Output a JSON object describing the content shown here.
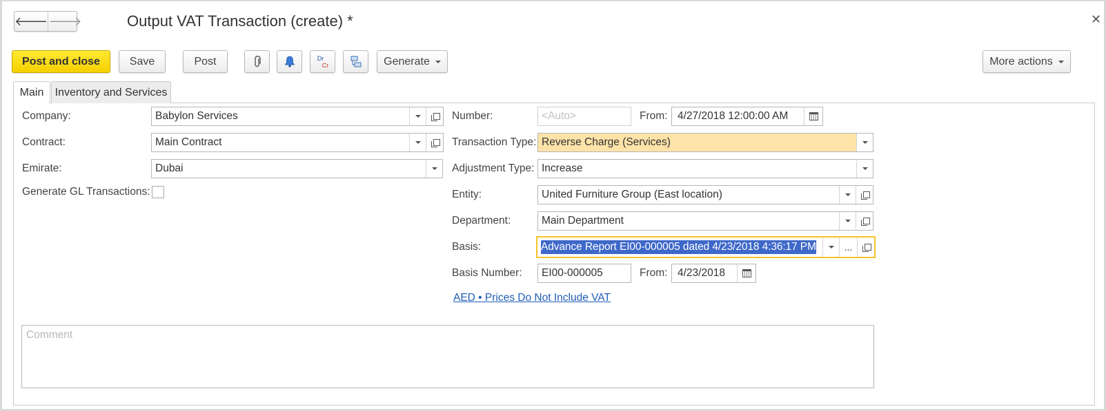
{
  "window": {
    "title": "Output VAT Transaction (create) *",
    "nav_back_icon": "arrow-left-icon",
    "nav_forward_icon": "arrow-right-icon",
    "close_icon": "close-icon"
  },
  "toolbar": {
    "post_and_close": "Post and close",
    "save": "Save",
    "post": "Post",
    "attach_icon": "paperclip-icon",
    "reminder_icon": "bell-icon",
    "drcr_dr": "Dr",
    "drcr_cr": "Cr",
    "structure_icon": "document-structure-icon",
    "generate": "Generate",
    "more_actions": "More actions"
  },
  "tabs": [
    {
      "label": "Main",
      "active": true
    },
    {
      "label": "Inventory and Services",
      "active": false
    }
  ],
  "left": {
    "company_label": "Company:",
    "company_value": "Babylon Services",
    "contract_label": "Contract:",
    "contract_value": "Main Contract",
    "emirate_label": "Emirate:",
    "emirate_value": "Dubai",
    "gl_label": "Generate GL Transactions:",
    "gl_checked": false
  },
  "right": {
    "number_label": "Number:",
    "number_placeholder": "<Auto>",
    "from_label": "From:",
    "from_value": "4/27/2018 12:00:00 AM",
    "ttype_label": "Transaction Type:",
    "ttype_value": "Reverse Charge (Services)",
    "adj_label": "Adjustment Type:",
    "adj_value": "Increase",
    "entity_label": "Entity:",
    "entity_value": "United Furniture Group (East location)",
    "dept_label": "Department:",
    "dept_value": "Main Department",
    "basis_label": "Basis:",
    "basis_value": "Advance Report EI00-000005 dated 4/23/2018 4:36:17 PM",
    "basis_dots": "...",
    "basis_number_label": "Basis Number:",
    "basis_number_value": "EI00-000005",
    "basis_from_label": "From:",
    "basis_from_value": "4/23/2018",
    "currency_link": "AED • Prices Do Not Include VAT"
  },
  "comment": {
    "placeholder": "Comment"
  },
  "colors": {
    "primary_button": "#f5d000",
    "highlight_field": "#fde3a8",
    "focus_border": "#f4c22b",
    "selection": "#3e68c9",
    "link": "#1f5db5"
  }
}
